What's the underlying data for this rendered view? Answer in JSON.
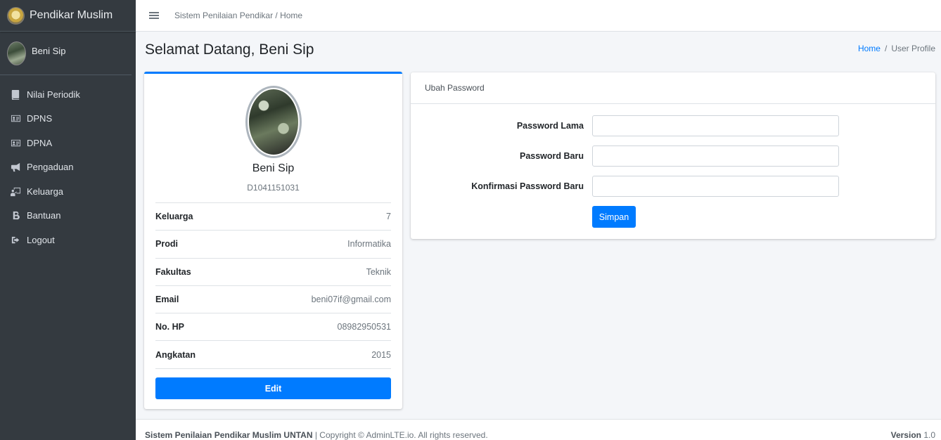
{
  "brand": {
    "title": "Pendikar Muslim"
  },
  "user": {
    "name": "Beni Sip"
  },
  "sidebar": {
    "items": [
      {
        "label": "Nilai Periodik",
        "icon": "book-icon"
      },
      {
        "label": "DPNS",
        "icon": "id-card-icon"
      },
      {
        "label": "DPNA",
        "icon": "id-card-icon"
      },
      {
        "label": "Pengaduan",
        "icon": "bullhorn-icon"
      },
      {
        "label": "Keluarga",
        "icon": "chalkboard-teacher-icon"
      },
      {
        "label": "Bantuan",
        "icon": "bold-b-icon"
      },
      {
        "label": "Logout",
        "icon": "sign-out-icon"
      }
    ]
  },
  "topbar": {
    "breadcrumb": "Sistem Penilaian Pendikar / Home"
  },
  "header": {
    "title": "Selamat Datang, Beni Sip",
    "breadcrumb_home": "Home",
    "breadcrumb_separator": "/",
    "breadcrumb_current": "User Profile"
  },
  "profile": {
    "name": "Beni Sip",
    "id": "D1041151031",
    "fields": [
      {
        "label": "Keluarga",
        "value": "7"
      },
      {
        "label": "Prodi",
        "value": "Informatika"
      },
      {
        "label": "Fakultas",
        "value": "Teknik"
      },
      {
        "label": "Email",
        "value": "beni07if@gmail.com"
      },
      {
        "label": "No. HP",
        "value": "08982950531"
      },
      {
        "label": "Angkatan",
        "value": "2015"
      }
    ],
    "edit_label": "Edit"
  },
  "password_form": {
    "title": "Ubah Password",
    "old_label": "Password Lama",
    "old_value": "",
    "new_label": "Password Baru",
    "new_value": "",
    "confirm_label": "Konfirmasi Password Baru",
    "confirm_value": "",
    "save_label": "Simpan"
  },
  "footer": {
    "app_name": "Sistem Penilaian Pendikar Muslim UNTAN",
    "copyright": " | Copyright © AdminLTE.io. All rights reserved.",
    "version_label": "Version",
    "version_value": " 1.0"
  },
  "colors": {
    "sidebar_bg": "#343a40",
    "primary": "#007bff",
    "content_bg": "#f4f6f9"
  }
}
